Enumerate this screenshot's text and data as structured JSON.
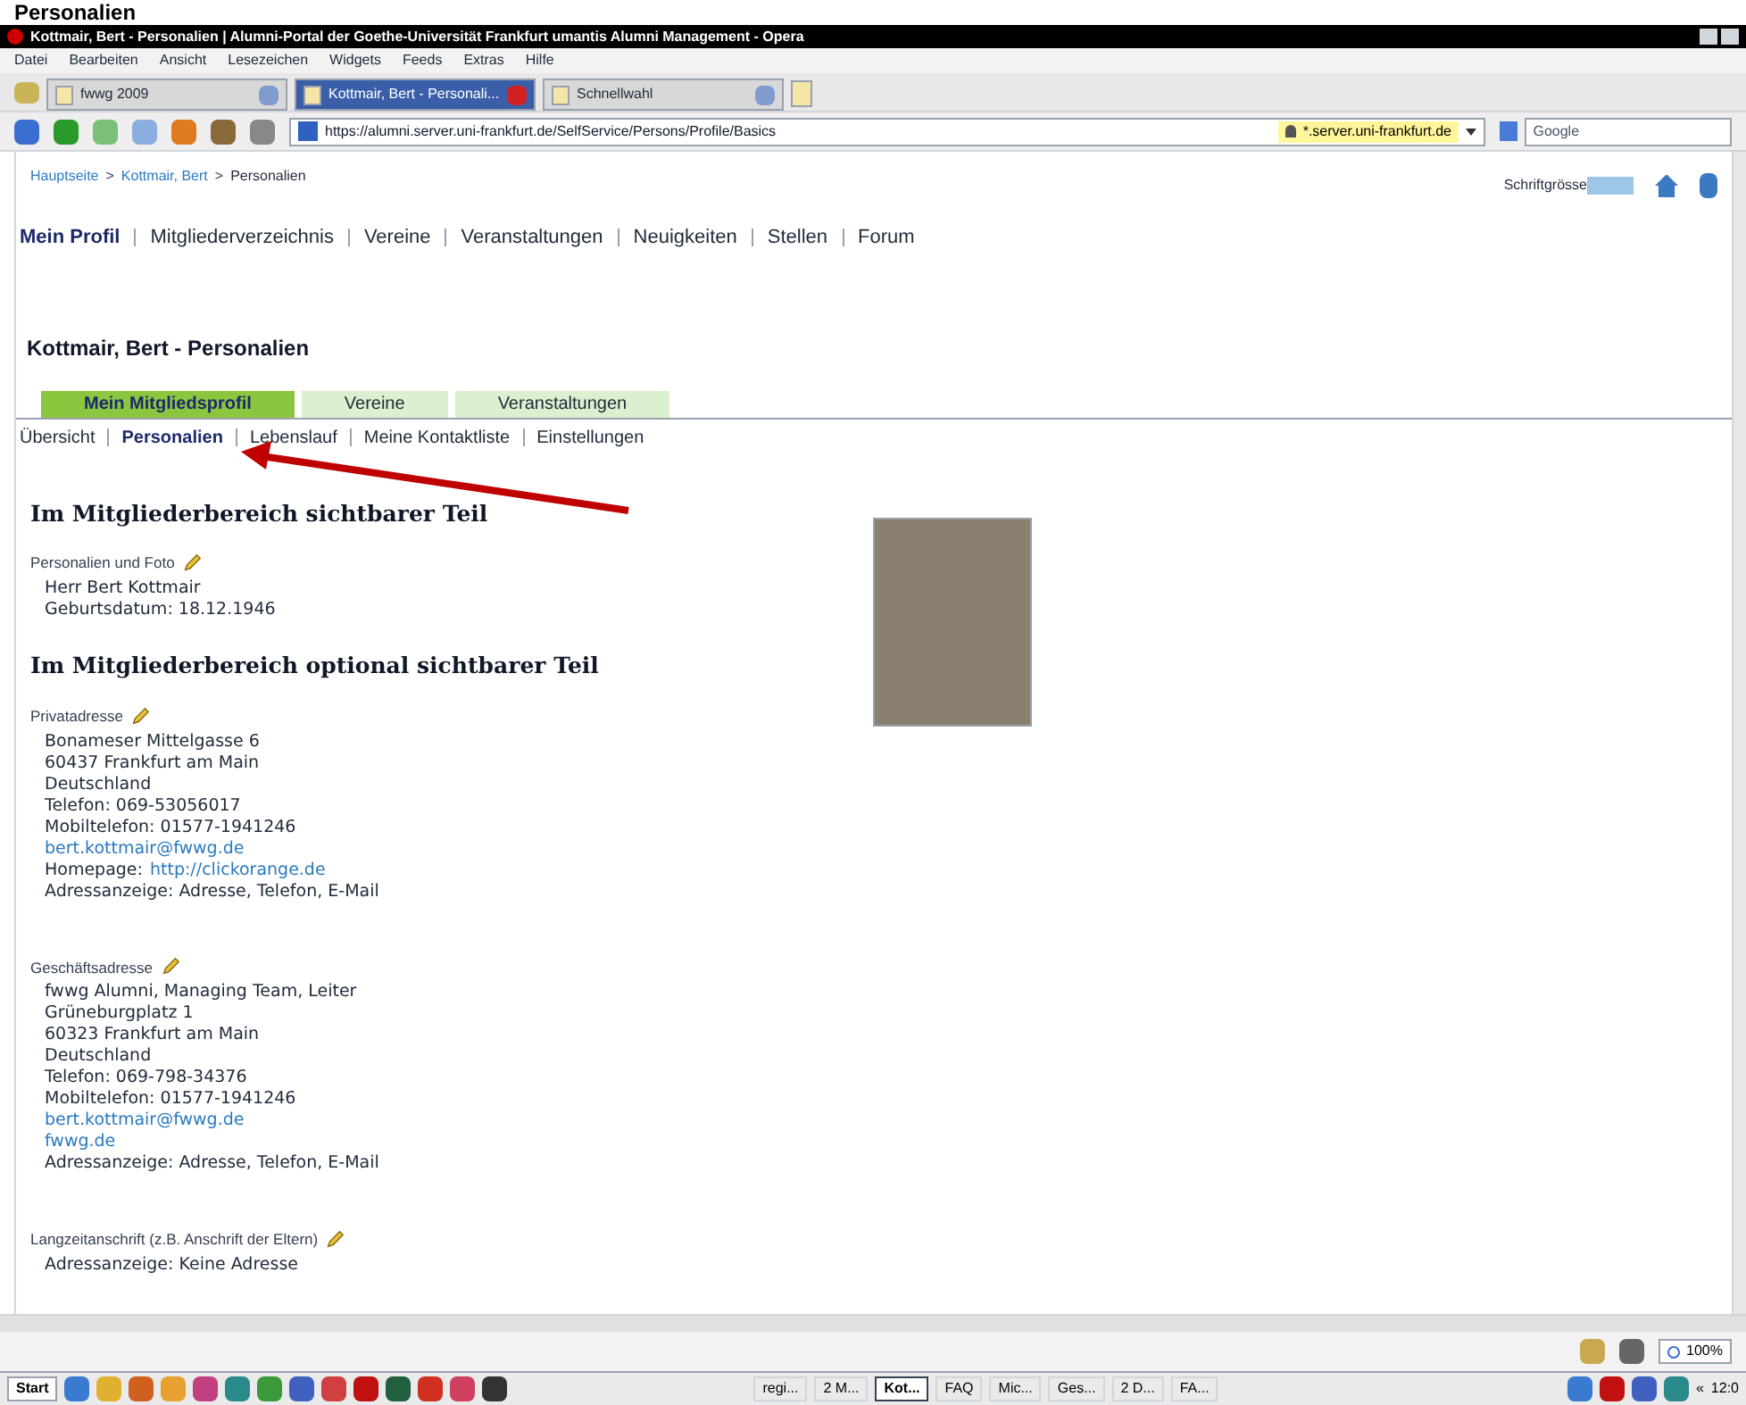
{
  "caption": "Personalien",
  "window": {
    "title": "Kottmair, Bert - Personalien | Alumni-Portal der Goethe-Universität Frankfurt umantis Alumni Management - Opera"
  },
  "menu": [
    "Datei",
    "Bearbeiten",
    "Ansicht",
    "Lesezeichen",
    "Widgets",
    "Feeds",
    "Extras",
    "Hilfe"
  ],
  "browser_tabs": [
    {
      "label": "fwwg 2009",
      "selected": false
    },
    {
      "label": "Kottmair, Bert - Personali...",
      "selected": true
    },
    {
      "label": "Schnellwahl",
      "selected": false
    }
  ],
  "address_bar": {
    "url": "https://alumni.server.uni-frankfurt.de/SelfService/Persons/Profile/Basics",
    "security": "*.server.uni-frankfurt.de",
    "search_placeholder": "Google"
  },
  "breadcrumb": [
    "Hauptseite",
    "Kottmair, Bert",
    "Personalien"
  ],
  "breadcrumb_separator": ">",
  "font_size_label": "Schriftgrösse",
  "main_nav": [
    {
      "label": "Mein Profil",
      "selected": true
    },
    {
      "label": "Mitgliederverzeichnis",
      "selected": false
    },
    {
      "label": "Vereine",
      "selected": false
    },
    {
      "label": "Veranstaltungen",
      "selected": false
    },
    {
      "label": "Neuigkeiten",
      "selected": false
    },
    {
      "label": "Stellen",
      "selected": false
    },
    {
      "label": "Forum",
      "selected": false
    }
  ],
  "page_title": "Kottmair, Bert - Personalien",
  "page_tabs": [
    {
      "label": "Mein Mitgliedsprofil",
      "selected": true
    },
    {
      "label": "Vereine",
      "selected": false
    },
    {
      "label": "Veranstaltungen",
      "selected": false
    }
  ],
  "sub_nav": [
    {
      "label": "Übersicht",
      "selected": false
    },
    {
      "label": "Personalien",
      "selected": true
    },
    {
      "label": "Lebenslauf",
      "selected": false
    },
    {
      "label": "Meine Kontaktliste",
      "selected": false
    },
    {
      "label": "Einstellungen",
      "selected": false
    }
  ],
  "sections": [
    {
      "heading": "Im Mitgliederbereich sichtbarer Teil",
      "blocks": [
        {
          "label": "Personalien und Foto",
          "lines": [
            {
              "kind": "text",
              "text": "Herr Bert Kottmair"
            },
            {
              "kind": "text",
              "text": "Geburtsdatum: 18.12.1946"
            }
          ]
        }
      ]
    },
    {
      "heading": "Im Mitgliederbereich optional sichtbarer Teil",
      "blocks": [
        {
          "label": "Privatadresse",
          "lines": [
            {
              "kind": "text",
              "text": "Bonameser Mittelgasse 6"
            },
            {
              "kind": "text",
              "text": "60437 Frankfurt am Main"
            },
            {
              "kind": "text",
              "text": "Deutschland"
            },
            {
              "kind": "text",
              "text": "Telefon: 069-53056017"
            },
            {
              "kind": "text",
              "text": "Mobiltelefon: 01577-1941246"
            },
            {
              "kind": "link",
              "text": "bert.kottmair@fwwg.de"
            },
            {
              "kind": "labeled_link",
              "label": "Homepage:",
              "text": "http://clickorange.de"
            },
            {
              "kind": "text",
              "text": "Adressanzeige: Adresse, Telefon, E-Mail"
            }
          ]
        },
        {
          "label": "Geschäftsadresse",
          "lines": [
            {
              "kind": "text",
              "text": "fwwg Alumni, Managing Team, Leiter"
            },
            {
              "kind": "text",
              "text": "Grüneburgplatz 1"
            },
            {
              "kind": "text",
              "text": "60323 Frankfurt am Main"
            },
            {
              "kind": "text",
              "text": "Deutschland"
            },
            {
              "kind": "text",
              "text": "Telefon: 069-798-34376"
            },
            {
              "kind": "text",
              "text": "Mobiltelefon: 01577-1941246"
            },
            {
              "kind": "link",
              "text": "bert.kottmair@fwwg.de"
            },
            {
              "kind": "link",
              "text": "fwwg.de"
            },
            {
              "kind": "text",
              "text": "Adressanzeige: Adresse, Telefon, E-Mail"
            }
          ]
        },
        {
          "label": "Langzeitanschrift (z.B. Anschrift der Eltern)",
          "lines": [
            {
              "kind": "text",
              "text": "Adressanzeige: Keine Adresse"
            }
          ]
        }
      ]
    }
  ],
  "status_bar": {
    "zoom": "100%"
  },
  "taskbar": {
    "start": "Start",
    "tasks": [
      {
        "label": "regi...",
        "selected": false
      },
      {
        "label": "2 M...",
        "selected": false
      },
      {
        "label": "Kot...",
        "selected": true
      },
      {
        "label": "FAQ",
        "selected": false
      },
      {
        "label": "Mic...",
        "selected": false
      },
      {
        "label": "Ges...",
        "selected": false
      },
      {
        "label": "2 D...",
        "selected": false
      },
      {
        "label": "FA...",
        "selected": false
      }
    ],
    "tray_expand": "«",
    "clock": "12:0"
  }
}
